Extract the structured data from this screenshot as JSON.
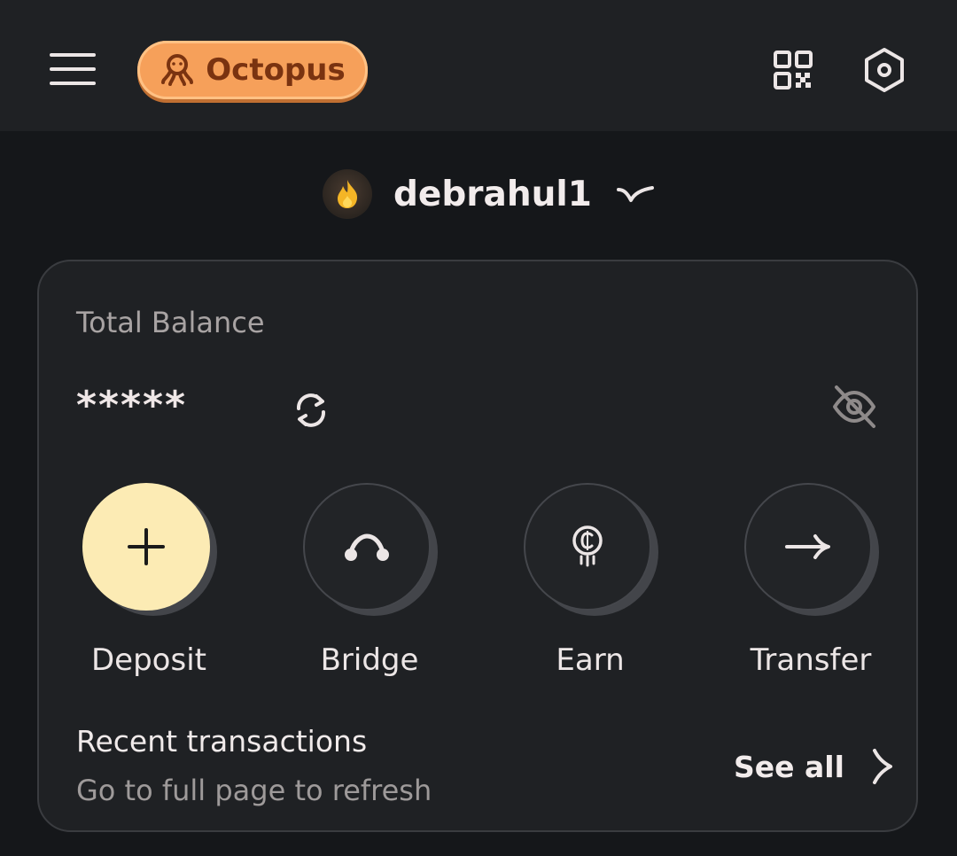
{
  "header": {
    "brand_label": "Octopus",
    "icons": {
      "menu": "hamburger-menu-icon",
      "brand": "octopus-icon",
      "qr": "qr-code-icon",
      "settings": "settings-hexagon-icon"
    }
  },
  "account": {
    "name": "debrahul1",
    "avatar_icon": "flame-icon",
    "chevron_icon": "chevron-down-icon"
  },
  "balance": {
    "label": "Total Balance",
    "value": "*****",
    "refresh_icon": "refresh-icon",
    "visibility_icon": "eye-off-icon"
  },
  "actions": [
    {
      "label": "Deposit",
      "icon": "plus-icon"
    },
    {
      "label": "Bridge",
      "icon": "bridge-icon"
    },
    {
      "label": "Earn",
      "icon": "coin-icon"
    },
    {
      "label": "Transfer",
      "icon": "arrow-right-icon"
    }
  ],
  "recent": {
    "title": "Recent transactions",
    "subtitle": "Go to full page to refresh",
    "see_all_label": "See all",
    "see_all_icon": "chevron-right-icon"
  },
  "colors": {
    "background": "#15171a",
    "surface": "#1f2124",
    "brand": "#f6a05a",
    "deposit_accent": "#fcebb4"
  }
}
